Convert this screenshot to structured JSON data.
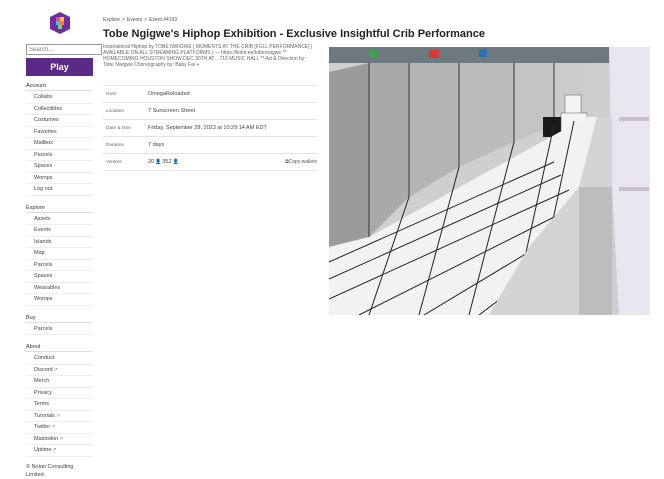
{
  "sidebar": {
    "search_placeholder": "Search...",
    "play_label": "Play",
    "sections": [
      {
        "title": "Account",
        "items": [
          {
            "label": "Collabs"
          },
          {
            "label": "Collectibles"
          },
          {
            "label": "Costumes"
          },
          {
            "label": "Favorites"
          },
          {
            "label": "Mailbox"
          },
          {
            "label": "Parcels"
          },
          {
            "label": "Spaces"
          },
          {
            "label": "Womps"
          },
          {
            "label": "Log out"
          }
        ]
      },
      {
        "title": "Explore",
        "items": [
          {
            "label": "Assets"
          },
          {
            "label": "Events"
          },
          {
            "label": "Islands"
          },
          {
            "label": "Map"
          },
          {
            "label": "Parcels"
          },
          {
            "label": "Spaces"
          },
          {
            "label": "Wearables"
          },
          {
            "label": "Womps"
          }
        ]
      },
      {
        "title": "Buy",
        "items": [
          {
            "label": "Parcels"
          }
        ]
      },
      {
        "title": "About",
        "items": [
          {
            "label": "Conduct"
          },
          {
            "label": "Discord",
            "ext": true
          },
          {
            "label": "Merch"
          },
          {
            "label": "Privacy"
          },
          {
            "label": "Terms"
          },
          {
            "label": "Tutorials",
            "ext": true
          },
          {
            "label": "Twitter",
            "ext": true
          },
          {
            "label": "Mastodon",
            "ext": true
          },
          {
            "label": "Uptime",
            "ext": true
          }
        ]
      }
    ],
    "ext_icon": "↗",
    "copyright": "© Nolan Consulting Limited"
  },
  "breadcrumb": {
    "items": [
      "Explore",
      "Events",
      "Event #4193"
    ],
    "separator": ">"
  },
  "event": {
    "title": "Tobe Ngigwe's Hiphop Exhibition - Exclusive Insightful Crib Performance",
    "description": "Inspirational Hiphop by TOBE NWIGWE | MOMENTS AT THE CRIB [FULL PERFORMANCE] | AVAILABLE ON ALL STREAMING PLATFORMS | — https://linktr.ee/tobenwigwe ** HOMECOMING HOUSTON SHOW DEC 30TH AT... 713 MUSIC HALL ** Art & Direction by: Tobe Nwigwe Choreography by: Baby Fai +",
    "details": {
      "host_label": "Host",
      "host_value": "OmegaReloaded",
      "location_label": "Location",
      "location_value": "7 Sunscreen Street",
      "datetime_label": "Date & time",
      "datetime_value": "Friday, September 29, 2023 at 10:29:14 AM EDT",
      "duration_label": "Duration",
      "duration_value": "7 days",
      "visitors_label": "Visitors",
      "visitors_count_a": "20",
      "visitors_count_b": "352",
      "copy_label": "Copy wallets"
    }
  },
  "colors": {
    "play_button": "#5b2a86",
    "logo": "#6b2fa0"
  },
  "icons": {
    "person": "person-icon",
    "copy": "copy-icon",
    "external": "external-link-icon"
  }
}
